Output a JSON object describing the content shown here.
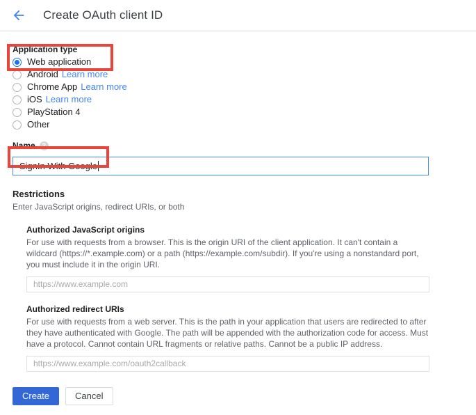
{
  "header": {
    "back_icon": "arrow-left-icon",
    "title": "Create OAuth client ID"
  },
  "application_type": {
    "label": "Application type",
    "selected": "Web application",
    "options": [
      {
        "label": "Web application",
        "selected": true,
        "learn_more": ""
      },
      {
        "label": "Android",
        "selected": false,
        "learn_more": "Learn more"
      },
      {
        "label": "Chrome App",
        "selected": false,
        "learn_more": "Learn more"
      },
      {
        "label": "iOS",
        "selected": false,
        "learn_more": "Learn more"
      },
      {
        "label": "PlayStation 4",
        "selected": false,
        "learn_more": ""
      },
      {
        "label": "Other",
        "selected": false,
        "learn_more": ""
      }
    ]
  },
  "name_field": {
    "label": "Name",
    "help_icon": "help-circle-icon",
    "help_glyph": "?",
    "value": "SignIn With Google"
  },
  "restrictions": {
    "title": "Restrictions",
    "subtitle": "Enter JavaScript origins, redirect URIs, or both",
    "javascript_origins": {
      "title": "Authorized JavaScript origins",
      "description": "For use with requests from a browser. This is the origin URI of the client application. It can't contain a wildcard (https://*.example.com) or a path (https://example.com/subdir). If you're using a nonstandard port, you must include it in the origin URI.",
      "placeholder": "https://www.example.com",
      "value": ""
    },
    "redirect_uris": {
      "title": "Authorized redirect URIs",
      "description": "For use with requests from a web server. This is the path in your application that users are redirected to after they have authenticated with Google. The path will be appended with the authorization code for access. Must have a protocol. Cannot contain URL fragments or relative paths. Cannot be a public IP address.",
      "placeholder": "https://www.example.com/oauth2callback",
      "value": ""
    }
  },
  "actions": {
    "create_label": "Create",
    "cancel_label": "Cancel"
  },
  "colors": {
    "accent_blue": "#1a73e8",
    "link_blue": "#4285f4",
    "primary_button": "#3367d6",
    "annotation_red": "#e8453c",
    "muted_text": "#5f6368"
  }
}
